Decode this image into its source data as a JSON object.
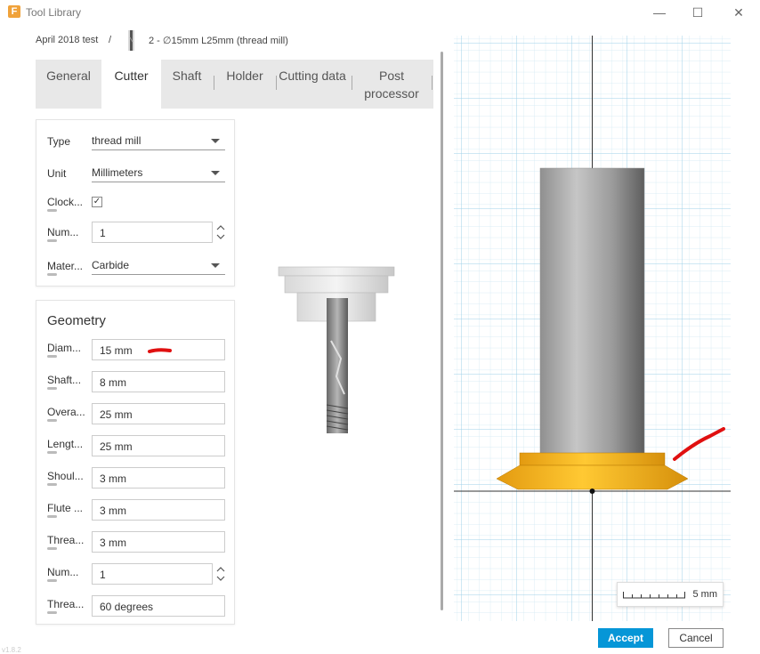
{
  "window": {
    "title": "Tool Library",
    "minimize": "—",
    "maximize": "☐",
    "close": "✕"
  },
  "breadcrumb": {
    "library": "April 2018 test",
    "separator": "/",
    "tool": "2 - ∅15mm L25mm (thread mill)"
  },
  "tabs": [
    {
      "label": "General"
    },
    {
      "label": "Cutter"
    },
    {
      "label": "Shaft"
    },
    {
      "label": "Holder"
    },
    {
      "label": "Cutting data"
    },
    {
      "label": "Post processor"
    }
  ],
  "cutter": {
    "type_label": "Type",
    "type_value": "thread mill",
    "unit_label": "Unit",
    "unit_value": "Millimeters",
    "clockwise_label": "Clock...",
    "clockwise_check": "✓",
    "number_label": "Num...",
    "number_value": "1",
    "material_label": "Mater...",
    "material_value": "Carbide"
  },
  "geometry": {
    "title": "Geometry",
    "rows": [
      {
        "label": "Diam...",
        "value": "15 mm"
      },
      {
        "label": "Shaft...",
        "value": "8 mm"
      },
      {
        "label": "Overa...",
        "value": "25 mm"
      },
      {
        "label": "Lengt...",
        "value": "25 mm"
      },
      {
        "label": "Shoul...",
        "value": "3 mm"
      },
      {
        "label": "Flute ...",
        "value": "3 mm"
      },
      {
        "label": "Threa...",
        "value": "3 mm"
      },
      {
        "label": "Num...",
        "value": "1"
      },
      {
        "label": "Threa...",
        "value": "60 degrees"
      }
    ]
  },
  "preview": {
    "scale_label": "5 mm"
  },
  "footer": {
    "accept": "Accept",
    "cancel": "Cancel",
    "version": "v1.8.2"
  },
  "colors": {
    "accent": "#0696d7",
    "grid": "#c9e6f2",
    "tool_body": "#a6a6a6",
    "cutter": "#f5b01e",
    "annotation": "#e01010"
  }
}
